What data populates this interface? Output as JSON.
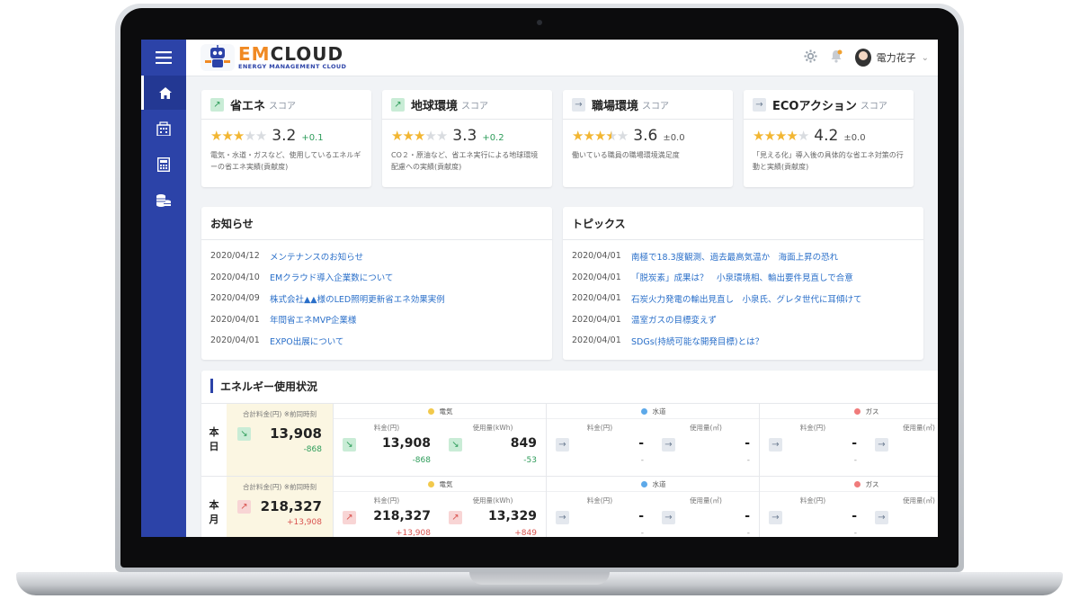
{
  "logo": {
    "em": "EM",
    "cloud": "CLOUD",
    "subtitle": "ENERGY MANAGEMENT CLOUD"
  },
  "header": {
    "user_name": "電力花子"
  },
  "icons": {
    "menu": "hamburger-icon",
    "home": "home-icon",
    "building": "building-icon",
    "calculator": "calculator-icon",
    "coins": "coins-icon",
    "settings": "gear-icon",
    "notifications": "bell-icon",
    "user": "avatar-icon",
    "dropdown": "chevron-down-icon"
  },
  "colors": {
    "sidebar": "#2c43a8",
    "accent_orange": "#f08a24",
    "link": "#2a6fc9",
    "positive": "#2e9c5a",
    "negative": "#d9534f",
    "star": "#f2b632"
  },
  "scores": [
    {
      "title": "省エネ",
      "suffix": "スコア",
      "trend": "up",
      "rating": 3.2,
      "value": "3.2",
      "diff": "+0.1",
      "desc": "電気・水道・ガスなど、使用しているエネルギーの省エネ実績(貢献度)"
    },
    {
      "title": "地球環境",
      "suffix": "スコア",
      "trend": "up",
      "rating": 3.3,
      "value": "3.3",
      "diff": "+0.2",
      "desc": "CO２・原油など、省エネ実行による地球環境配慮への実績(貢献度)"
    },
    {
      "title": "職場環境",
      "suffix": "スコア",
      "trend": "flat",
      "rating": 3.6,
      "value": "3.6",
      "diff": "±0.0",
      "desc": "働いている職員の職場環境満足度"
    },
    {
      "title": "ECOアクション",
      "suffix": "スコア",
      "trend": "flat",
      "rating": 4.2,
      "value": "4.2",
      "diff": "±0.0",
      "desc": "「見える化」導入後の具体的な省エネ対策の行動と実績(貢献度)"
    }
  ],
  "notices": {
    "title": "お知らせ",
    "items": [
      {
        "date": "2020/04/12",
        "text": "メンテナンスのお知らせ"
      },
      {
        "date": "2020/04/10",
        "text": "EMクラウド導入企業数について"
      },
      {
        "date": "2020/04/09",
        "text": "株式会社▲▲様のLED照明更新省エネ効果実例"
      },
      {
        "date": "2020/04/01",
        "text": "年間省エネMVP企業様"
      },
      {
        "date": "2020/04/01",
        "text": "EXPO出展について"
      }
    ]
  },
  "topics": {
    "title": "トピックス",
    "items": [
      {
        "date": "2020/04/01",
        "text": "南極で18.3度観測、過去最高気温か　海面上昇の恐れ"
      },
      {
        "date": "2020/04/01",
        "text": "「脱炭素」成果は？　小泉環境相、輸出要件見直しで合意"
      },
      {
        "date": "2020/04/01",
        "text": "石炭火力発電の輸出見直し　小泉氏、グレタ世代に耳傾けて"
      },
      {
        "date": "2020/04/01",
        "text": "温室ガスの目標変えず"
      },
      {
        "date": "2020/04/01",
        "text": "SDGs(持続可能な開発目標)とは？"
      }
    ]
  },
  "energy": {
    "title": "エネルギー使用状況",
    "categories": [
      {
        "name": "電気",
        "color": "#f2c94c"
      },
      {
        "name": "水道",
        "color": "#5da9e9"
      },
      {
        "name": "ガス",
        "color": "#f07b7b"
      }
    ],
    "rows": [
      {
        "label_top": "本",
        "label_bottom": "日",
        "total": {
          "label": "合計料金(円) ※前同時刻",
          "value": "13,908",
          "diff": "-868",
          "trend": "down"
        },
        "cells": [
          {
            "label": "料金(円)",
            "value": "13,908",
            "diff": "-868",
            "trend": "down"
          },
          {
            "label": "使用量(kWh)",
            "value": "849",
            "diff": "-53",
            "trend": "down"
          },
          {
            "label": "料金(円)",
            "value": "-",
            "diff": "-",
            "trend": "flat"
          },
          {
            "label": "使用量(㎥)",
            "value": "-",
            "diff": "-",
            "trend": "flat"
          },
          {
            "label": "料金(円)",
            "value": "-",
            "diff": "-",
            "trend": "flat"
          },
          {
            "label": "使用量(㎥)",
            "value": "-",
            "diff": "-",
            "trend": "flat"
          }
        ]
      },
      {
        "label_top": "本",
        "label_bottom": "月",
        "total": {
          "label": "合計料金(円) ※前同時刻",
          "value": "218,327",
          "diff": "+13,908",
          "trend": "up"
        },
        "cells": [
          {
            "label": "料金(円)",
            "value": "218,327",
            "diff": "+13,908",
            "trend": "up"
          },
          {
            "label": "使用量(kWh)",
            "value": "13,329",
            "diff": "+849",
            "trend": "up"
          },
          {
            "label": "料金(円)",
            "value": "-",
            "diff": "-",
            "trend": "flat"
          },
          {
            "label": "使用量(㎥)",
            "value": "-",
            "diff": "-",
            "trend": "flat"
          },
          {
            "label": "料金(円)",
            "value": "-",
            "diff": "-",
            "trend": "flat"
          },
          {
            "label": "使用量(㎥)",
            "value": "-",
            "diff": "-",
            "trend": "flat"
          }
        ]
      }
    ]
  }
}
